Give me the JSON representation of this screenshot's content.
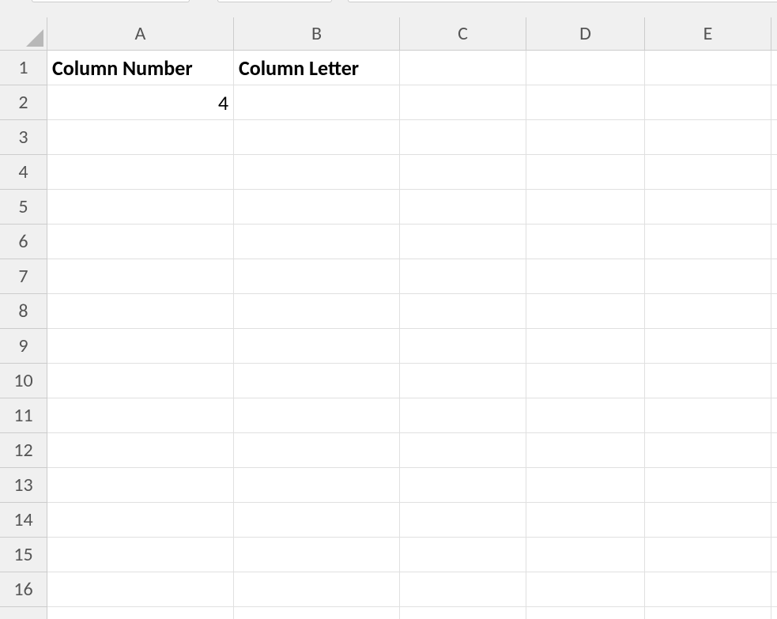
{
  "columns": [
    "A",
    "B",
    "C",
    "D",
    "E"
  ],
  "row_numbers": [
    1,
    2,
    3,
    4,
    5,
    6,
    7,
    8,
    9,
    10,
    11,
    12,
    13,
    14,
    15,
    16
  ],
  "cells": {
    "A1": {
      "value": "Column Number",
      "bold": true,
      "align": "left"
    },
    "B1": {
      "value": "Column Letter",
      "bold": true,
      "align": "left"
    },
    "A2": {
      "value": "4",
      "bold": false,
      "align": "right"
    }
  }
}
